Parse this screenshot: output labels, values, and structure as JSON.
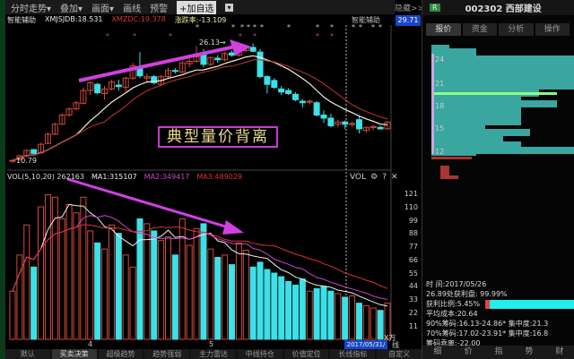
{
  "toolbar": {
    "items": [
      "分时走势▾",
      "叠加▾",
      "画面▾",
      "画线",
      "预警"
    ],
    "add_fav": "+加自选",
    "dropdown": "▾",
    "hide": "隐藏>>"
  },
  "info": {
    "label": "智能辅助",
    "xmjs": "XMJSJDB:18.531",
    "xmzdc": "XMZDC:19.378",
    "zhl": "涨跌率:-13.109",
    "assist": "智能辅助",
    "current_price": "29.71"
  },
  "annotation": {
    "high": "26.13",
    "low": "10.79",
    "label": "典型量价背离"
  },
  "volume": {
    "title": "VOL(5,10,20)",
    "vol": "262163",
    "ma1": "MA1:315107",
    "ma2": "MA2:349417",
    "ma3": "MA3:489029",
    "tool_label": "VOL",
    "unit": "X万",
    "axis": [
      "121",
      "110",
      "99",
      "88",
      "77",
      "66",
      "55",
      "44",
      "33",
      "22",
      "11"
    ]
  },
  "xaxis": {
    "m4": "4",
    "m5": "5",
    "date": "2017/05/31/三",
    "line": "线"
  },
  "bottom_tabs": [
    "默认",
    "买卖决策",
    "超级趋势",
    "趋势强弱",
    "主力雷达",
    "中线持仓",
    "价值定位",
    "长线指标",
    "自定义"
  ],
  "right": {
    "badge": "R",
    "code": "002302 西部建设",
    "tabs": [
      "报价",
      "资金",
      "分析",
      "操作"
    ],
    "price_axis": [
      "24",
      "21",
      "18",
      "15",
      "12"
    ],
    "info": [
      "时          间:2017/05/26",
      "26.89处获利盘: 99.99%",
      "获利比例:5.45%",
      "平均成本:20.64",
      "90%筹码:16.13-24.86* 集中度:21.3",
      "70%筹码:17.02-23.91* 集中度:16.8",
      "筹码乖离:-22.00"
    ],
    "profit_ratio": 0.0545,
    "bottom_tabs": [
      "细",
      "价",
      "指",
      "势",
      "财"
    ]
  },
  "colors": {
    "up": "#d04a3a",
    "down": "#3de0e6",
    "ma_short": "#f0f0e0",
    "ma_long": "#c03a2e",
    "arrow": "#d040e0"
  },
  "chart_data": {
    "type": "candlestick",
    "ylim": [
      10,
      27
    ],
    "ohlc": [
      [
        10.8,
        11,
        10.6,
        10.9
      ],
      [
        11,
        11.6,
        10.9,
        11.5
      ],
      [
        11.5,
        12.3,
        11.3,
        12.2
      ],
      [
        12.3,
        12.4,
        11.7,
        11.8
      ],
      [
        11.9,
        13.2,
        11.8,
        13
      ],
      [
        13.1,
        14.5,
        13,
        14.3
      ],
      [
        14.3,
        15.8,
        14.2,
        15.6
      ],
      [
        15.6,
        17,
        15.5,
        16.8
      ],
      [
        16.8,
        17.8,
        16.6,
        17.6
      ],
      [
        17.6,
        18.6,
        17.4,
        18.4
      ],
      [
        18.3,
        20.4,
        18.2,
        20
      ],
      [
        20,
        21.2,
        19.4,
        21
      ],
      [
        20.8,
        21,
        19.5,
        19.7
      ],
      [
        19.6,
        20.6,
        18.8,
        20.2
      ],
      [
        20.2,
        21.4,
        20,
        21.1
      ],
      [
        20.7,
        21.4,
        20,
        20.5
      ],
      [
        20.4,
        21.8,
        19.8,
        21.6
      ],
      [
        21.6,
        23.6,
        21.4,
        23.2
      ],
      [
        23,
        25,
        21.6,
        21.9
      ],
      [
        21.6,
        22.2,
        21,
        21.8
      ],
      [
        21.8,
        22,
        20.8,
        21
      ],
      [
        20.8,
        22,
        20.6,
        21.8
      ],
      [
        21.8,
        23,
        21.6,
        22.6
      ],
      [
        22.6,
        22.9,
        22.2,
        22.5
      ],
      [
        22.4,
        23.8,
        22.3,
        23.6
      ],
      [
        23.5,
        24.6,
        23,
        23.8
      ],
      [
        23.8,
        25.8,
        23.6,
        24.4
      ],
      [
        24.6,
        25.4,
        23,
        23.4
      ],
      [
        23.4,
        24.4,
        23.2,
        24.3
      ],
      [
        24.2,
        24.6,
        23.6,
        24
      ],
      [
        24,
        25,
        23.8,
        24.8
      ],
      [
        24.9,
        25.2,
        24.4,
        24.6
      ],
      [
        24.6,
        25.4,
        24.4,
        25.2
      ],
      [
        25.2,
        25.8,
        25,
        25.6
      ],
      [
        25.6,
        26.13,
        25,
        25.1
      ],
      [
        25,
        25.4,
        21.6,
        21.8
      ],
      [
        21.8,
        22,
        19.6,
        20.8
      ],
      [
        21.3,
        21.6,
        20.2,
        20.4
      ],
      [
        20.2,
        20.6,
        19.4,
        19.8
      ],
      [
        20,
        20.3,
        19.4,
        19.6
      ],
      [
        19.5,
        19.8,
        18.6,
        18.8
      ],
      [
        18.6,
        18.9,
        17.8,
        18.4
      ],
      [
        18.5,
        18.8,
        18.2,
        18.6
      ],
      [
        18.4,
        18.6,
        16.6,
        16.8
      ],
      [
        16.8,
        17.4,
        15.8,
        16.4
      ],
      [
        16.4,
        17,
        15.2,
        15.4
      ],
      [
        15.6,
        16.2,
        15.2,
        15.9
      ],
      [
        15.9,
        16.1,
        15,
        15.6
      ],
      [
        15.6,
        16,
        15.3,
        15.7
      ],
      [
        16.2,
        16.6,
        14.4,
        15
      ],
      [
        14.8,
        15.3,
        14.5,
        15.2
      ],
      [
        15.2,
        15.5,
        14.8,
        15.3
      ],
      [
        15.2,
        15.4,
        14.9,
        15
      ],
      [
        15,
        16,
        14.9,
        15.9
      ]
    ],
    "volume": [
      40,
      70,
      95,
      60,
      110,
      120,
      118,
      100,
      112,
      105,
      118,
      90,
      80,
      75,
      95,
      88,
      70,
      60,
      100,
      96,
      90,
      82,
      85,
      70,
      100,
      78,
      92,
      96,
      75,
      68,
      70,
      62,
      80,
      74,
      60,
      64,
      58,
      55,
      52,
      48,
      45,
      50,
      40,
      42,
      44,
      40,
      38,
      35,
      36,
      30,
      28,
      26,
      24,
      30
    ],
    "vlim": [
      0,
      121
    ]
  }
}
